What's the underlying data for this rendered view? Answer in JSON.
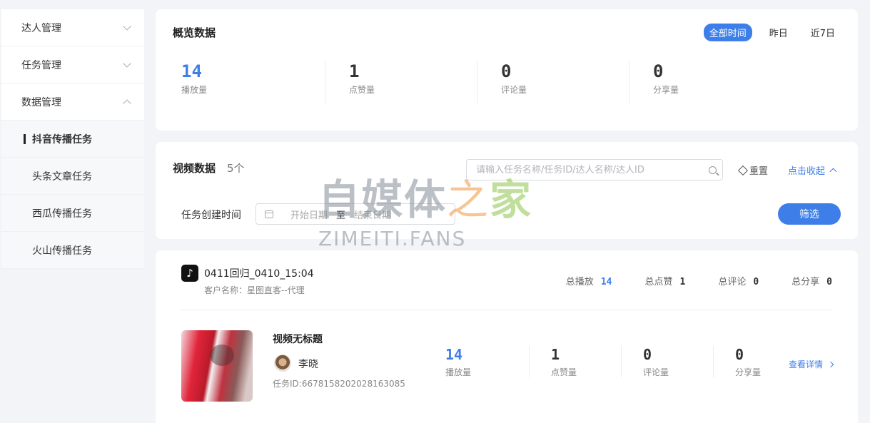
{
  "sidebar": {
    "groups": [
      {
        "label": "达人管理"
      },
      {
        "label": "任务管理"
      },
      {
        "label": "数据管理"
      }
    ],
    "subitems": [
      {
        "label": "抖音传播任务"
      },
      {
        "label": "头条文章任务"
      },
      {
        "label": "西瓜传播任务"
      },
      {
        "label": "火山传播任务"
      }
    ]
  },
  "overview": {
    "title": "概览数据",
    "time_tabs": [
      "全部时间",
      "昨日",
      "近7日"
    ],
    "stats": [
      {
        "value": "14",
        "label": "播放量"
      },
      {
        "value": "1",
        "label": "点赞量"
      },
      {
        "value": "0",
        "label": "评论量"
      },
      {
        "value": "0",
        "label": "分享量"
      }
    ]
  },
  "video_data": {
    "title": "视频数据",
    "count": "5个",
    "search_placeholder": "请输入任务名称/任务ID/达人名称/达人ID",
    "reset_label": "重置",
    "collapse_label": "点击收起",
    "filter_label": "任务创建时间",
    "start_placeholder": "开始日期",
    "range_sep": "至",
    "end_placeholder": "结束日期",
    "filter_button": "筛选"
  },
  "watermark": {
    "main": "自媒体",
    "zhi": "之",
    "jia": "家",
    "sub": "ZIMEITI.FANS"
  },
  "task": {
    "icon_glyph": "♪",
    "name": "0411回归_0410_15:04",
    "client": "客户名称：星图直客--代理",
    "totals": [
      {
        "label": "总播放",
        "value": "14"
      },
      {
        "label": "总点赞",
        "value": "1"
      },
      {
        "label": "总评论",
        "value": "0"
      },
      {
        "label": "总分享",
        "value": "0"
      }
    ],
    "video": {
      "title": "视频无标题",
      "author": "李晓",
      "task_id": "任务ID:6678158202028163085",
      "stats": [
        {
          "value": "14",
          "label": "播放量"
        },
        {
          "value": "1",
          "label": "点赞量"
        },
        {
          "value": "0",
          "label": "评论量"
        },
        {
          "value": "0",
          "label": "分享量"
        }
      ],
      "details_label": "查看详情"
    }
  },
  "colors": {
    "accent": "#3d7ee8",
    "background": "#f3f4f7"
  }
}
